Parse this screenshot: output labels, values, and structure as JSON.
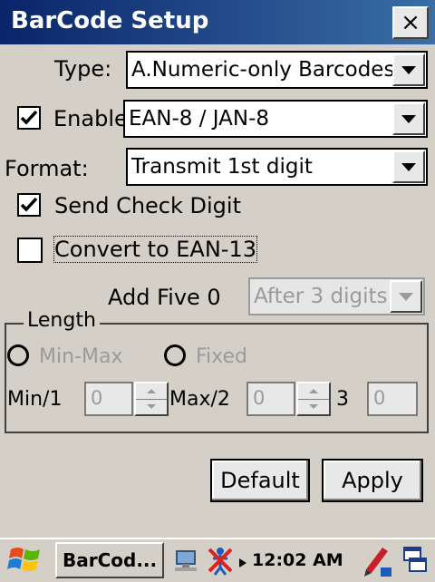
{
  "window": {
    "title": "BarCode Setup",
    "close_label": "×"
  },
  "type_row": {
    "label": "Type:",
    "value": "A.Numeric-only Barcodes"
  },
  "enable_row": {
    "label": "Enable",
    "checked": true,
    "value": "EAN-8 / JAN-8"
  },
  "format_row": {
    "label": "Format:",
    "value": "Transmit 1st digit"
  },
  "send_check_digit": {
    "label": "Send Check Digit",
    "checked": true
  },
  "convert_ean13": {
    "label": "Convert to EAN-13",
    "checked": false
  },
  "add_five_zero": {
    "label": "Add Five 0",
    "value": "After 3 digits"
  },
  "length": {
    "title": "Length",
    "radio_minmax": "Min-Max",
    "radio_fixed": "Fixed",
    "min_label": "Min/1",
    "min_value": "0",
    "max_label": "Max/2",
    "max_value": "0",
    "third_label": "3",
    "third_value": "0"
  },
  "buttons": {
    "default": "Default",
    "apply": "Apply"
  },
  "taskbar": {
    "task_label": "BarCod...",
    "clock": "12:02 AM"
  },
  "colors": {
    "title_bg": "#0a246a",
    "window_bg": "#d4d0c8",
    "disabled_text": "#9a9a9a"
  }
}
